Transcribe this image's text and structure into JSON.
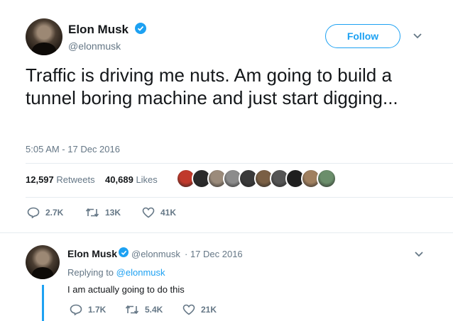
{
  "main_tweet": {
    "author_name": "Elon Musk",
    "author_handle": "@elonmusk",
    "follow_label": "Follow",
    "text": "Traffic is driving me nuts. Am going to build a tunnel boring machine and just start digging...",
    "timestamp": "5:05 AM - 17 Dec 2016",
    "retweets_count": "12,597",
    "retweets_label": "Retweets",
    "likes_count": "40,689",
    "likes_label": "Likes",
    "actions": {
      "replies": "2.7K",
      "retweets": "13K",
      "likes": "41K"
    },
    "liker_avatars": [
      "#c0392b",
      "#2b2b2b",
      "#9b8b7b",
      "#8c8c8c",
      "#3a3a3a",
      "#7a5f44",
      "#555555",
      "#1f1f1f",
      "#a08060",
      "#6b8e6b"
    ]
  },
  "reply_tweet": {
    "author_name": "Elon Musk",
    "author_handle": "@elonmusk",
    "date": "· 17 Dec 2016",
    "replying_prefix": "Replying to",
    "replying_handle": "@elonmusk",
    "text": "I am actually going to do this",
    "actions": {
      "replies": "1.7K",
      "retweets": "5.4K",
      "likes": "21K"
    }
  },
  "colors": {
    "accent": "#1da1f2",
    "muted": "#657786",
    "text": "#14171a",
    "border": "#e6ecf0"
  },
  "icons": [
    "verified-badge-icon",
    "chevron-down-icon",
    "reply-icon",
    "retweet-icon",
    "like-icon"
  ]
}
